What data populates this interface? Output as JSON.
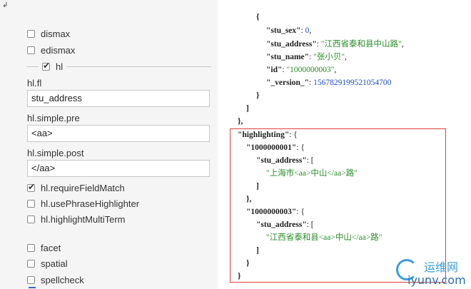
{
  "topmark": "↲",
  "form": {
    "dismax": {
      "label": "dismax",
      "checked": false
    },
    "edismax": {
      "label": "edismax",
      "checked": false
    },
    "hl": {
      "label": "hl",
      "checked": true
    },
    "hl_fl": {
      "label": "hl.fl",
      "value": "stu_address"
    },
    "hl_simple_pre": {
      "label": "hl.simple.pre",
      "value": "<aa>"
    },
    "hl_simple_post": {
      "label": "hl.simple.post",
      "value": "</aa>"
    },
    "hl_requireFieldMatch": {
      "label": "hl.requireFieldMatch",
      "checked": true
    },
    "hl_usePhraseHighlighter": {
      "label": "hl.usePhraseHighlighter",
      "checked": false
    },
    "hl_highlightMultiTerm": {
      "label": "hl.highlightMultiTerm",
      "checked": false
    },
    "facet": {
      "label": "facet",
      "checked": false
    },
    "spatial": {
      "label": "spatial",
      "checked": false
    },
    "spellcheck": {
      "label": "spellcheck",
      "checked": false
    }
  },
  "json": {
    "open_brace": "{",
    "k_stu_sex": "\"stu_sex\"",
    "v_stu_sex": "0",
    "k_stu_address": "\"stu_address\"",
    "v_stu_address": "\"江西省泰和县中山路\"",
    "k_stu_name": "\"stu_name\"",
    "v_stu_name": "\"张小贝\"",
    "k_id": "\"id\"",
    "v_id": "\"1000000003\"",
    "k_version": "\"_version_\"",
    "v_version": "1567829199521054700",
    "close_brace": "}",
    "close_bracket": "]",
    "close_brace_comma": "},",
    "k_highlighting": "\"highlighting\"",
    "k_doc1": "\"1000000001\"",
    "k_doc1_field": "\"stu_address\"",
    "v_doc1": "\"上海市<aa>中山</aa>路\"",
    "k_doc2": "\"1000000003\"",
    "k_doc2_field": "\"stu_address\"",
    "v_doc2": "\"江西省泰和县<aa>中山</aa>路\""
  },
  "watermark": {
    "cn": "运维网",
    "en": "iyunv.com",
    "color": "#3a9ee0"
  },
  "highlight_box_color": "#d9403a"
}
